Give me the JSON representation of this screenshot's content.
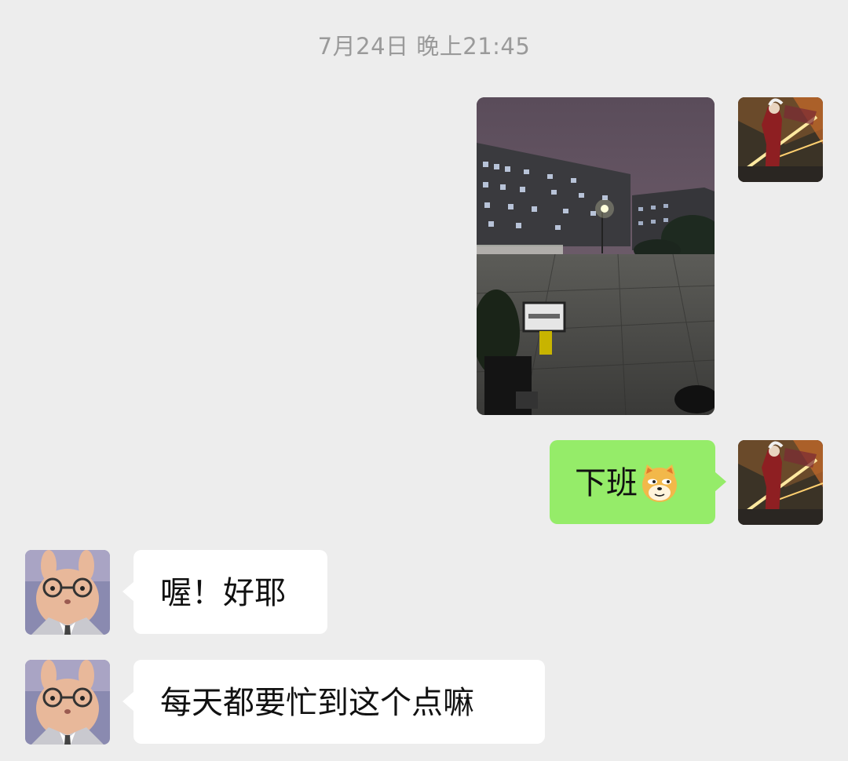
{
  "chat": {
    "timestamp": "7月24日 晚上21:45",
    "messages": [
      {
        "sender": "me",
        "type": "image",
        "avatar": "anime-warrior-avatar"
      },
      {
        "sender": "me",
        "type": "text",
        "text": "下班",
        "emoji": "doge-emoji",
        "avatar": "anime-warrior-avatar"
      },
      {
        "sender": "other",
        "type": "text",
        "text": "喔！好耶",
        "avatar": "rabbit-with-glasses-avatar"
      },
      {
        "sender": "other",
        "type": "text",
        "text": "每天都要忙到这个点嘛",
        "avatar": "rabbit-with-glasses-avatar"
      }
    ]
  },
  "colors": {
    "background": "#ededed",
    "my_bubble": "#95ec69",
    "their_bubble": "#ffffff",
    "timestamp_text": "#9a9a9a"
  }
}
